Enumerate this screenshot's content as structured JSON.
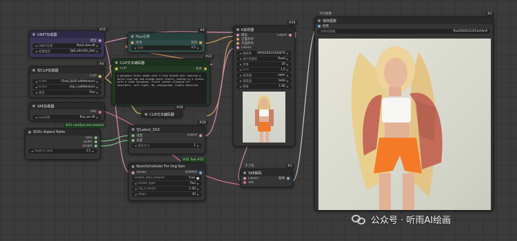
{
  "colors": {
    "wire_pink": "#d98fb5",
    "wire_yellow": "#d8c060",
    "wire_green": "#7cc27c",
    "wire_white": "#cccccc",
    "clip_green": "#223a22",
    "purple": "#3a3555"
  },
  "unet": {
    "badge": "#15",
    "title": "UNET加载器",
    "labels": [
      "UNET名称",
      "权重类型"
    ],
    "values": [
      "flux1-dev.sft",
      "fp8_e4m3fn_fast"
    ],
    "out": "模型"
  },
  "dualclip": {
    "badge": "#4",
    "title": "双CLIP加载器",
    "labels": [
      "CLIP1",
      "CLIP2",
      "类型"
    ],
    "values": [
      "t5xxl_fp16.safetensors",
      "clip_l.safetensors",
      "flux"
    ],
    "out": "CLIP"
  },
  "vae": {
    "badge": "",
    "title": "VAE加载器",
    "label": "vae名称",
    "value": "flux_ae.sft",
    "out": "VAE"
  },
  "sdxl": {
    "badge": "#31 comfyui-art-venture",
    "title": "SDXL Aspect Ratio",
    "outs": [
      "ratio",
      "width",
      "height"
    ],
    "label": "aspect_ratio",
    "value": "1:1"
  },
  "flux_guidance": {
    "badge": "#9",
    "title": "Flux引导",
    "in": "条件",
    "out": "条件",
    "label": "引导",
    "value": "3.5"
  },
  "clip_text": {
    "badge": "#22",
    "title": "CLIP文本编码器",
    "in": "CLIP",
    "out": "条件",
    "prompt": "a gorgeous Asian woman with a long blonde hair wearing a white crop top and orange sport shorts, posing in a studio with a light backdrop, floral jacket slipping off shoulders, soft light, 8k, photograph, highly detailed"
  },
  "clip_text2": {
    "badge": "#34",
    "title": "CLIP文本编码器"
  },
  "empty_latent": {
    "badge": "#30",
    "title": "空Latent_SD3",
    "ins": [
      "宽度",
      "高度"
    ],
    "out": "Latent",
    "label": "批次大小",
    "value": "1"
  },
  "scheduler": {
    "badge": "#35 Tool #25",
    "title": "BasicScheduler For Img Gen",
    "in": "model",
    "out": "SIGMAS",
    "labels": [
      "enable_bbd_sampler",
      "model_type",
      "cfg_rl_factor",
      "steps"
    ],
    "values": [
      "true",
      "flux",
      "1.00",
      "30"
    ]
  },
  "ksampler": {
    "badge": "#33",
    "title": "K采样器",
    "ins": [
      "模型",
      "正面条件",
      "负面条件",
      "Latent"
    ],
    "out": "Latent",
    "labels": [
      "随机种",
      "运行后操作",
      "步数",
      "CFG",
      "采样器",
      "调度器",
      "降噪"
    ],
    "values": [
      "395625615300670",
      "fixed",
      "30",
      "1.0",
      "euler",
      "beta",
      "1.00"
    ]
  },
  "vae_decode": {
    "badge": "#1",
    "title": "VAE解码",
    "header_tag": "卡丁机",
    "ins": [
      "Latent",
      "VAE"
    ],
    "out": "图像"
  },
  "save_image": {
    "badge": "#2",
    "title": "保存图像",
    "header_tag": "卡片图像",
    "in": "图像",
    "label": "文件名前缀",
    "value": "flux20241213/ComfyUI"
  },
  "watermark": "公众号 · 听雨AI绘画"
}
